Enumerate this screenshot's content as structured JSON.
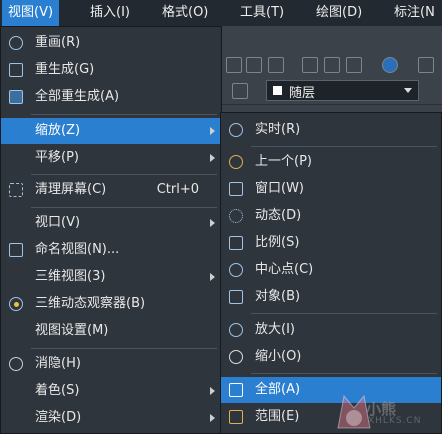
{
  "menubar": {
    "items": [
      "视图(V)",
      "插入(I)",
      "格式(O)",
      "工具(T)",
      "绘图(D)",
      "标注(N"
    ]
  },
  "layer": {
    "value": "随层"
  },
  "view_menu": {
    "items": [
      {
        "label": "重画(R)",
        "shortcut": ""
      },
      {
        "label": "重生成(G)",
        "shortcut": ""
      },
      {
        "label": "全部重生成(A)",
        "shortcut": ""
      },
      {
        "label": "缩放(Z)",
        "shortcut": ""
      },
      {
        "label": "平移(P)",
        "shortcut": ""
      },
      {
        "label": "清理屏幕(C)",
        "shortcut": "Ctrl+0"
      },
      {
        "label": "视口(V)",
        "shortcut": ""
      },
      {
        "label": "命名视图(N)...",
        "shortcut": ""
      },
      {
        "label": "三维视图(3)",
        "shortcut": ""
      },
      {
        "label": "三维动态观察器(B)",
        "shortcut": ""
      },
      {
        "label": "视图设置(M)",
        "shortcut": ""
      },
      {
        "label": "消隐(H)",
        "shortcut": ""
      },
      {
        "label": "着色(S)",
        "shortcut": ""
      },
      {
        "label": "渲染(D)",
        "shortcut": ""
      }
    ]
  },
  "zoom_menu": {
    "items": [
      {
        "label": "实时(R)"
      },
      {
        "label": "上一个(P)"
      },
      {
        "label": "窗口(W)"
      },
      {
        "label": "动态(D)"
      },
      {
        "label": "比例(S)"
      },
      {
        "label": "中心点(C)"
      },
      {
        "label": "对象(B)"
      },
      {
        "label": "放大(I)"
      },
      {
        "label": "缩小(O)"
      },
      {
        "label": "全部(A)"
      },
      {
        "label": "范围(E)"
      }
    ]
  },
  "watermark": {
    "text": "小熊",
    "sub": "XHLKS.CN"
  }
}
